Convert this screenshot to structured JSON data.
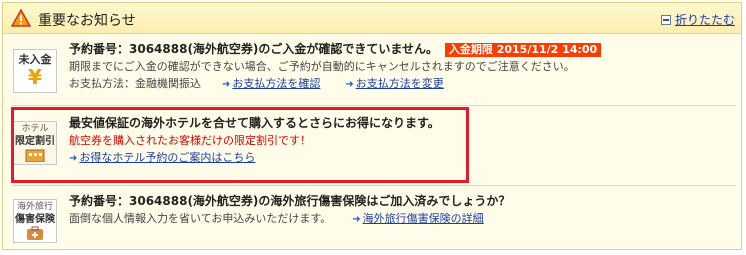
{
  "header": {
    "title": "重要なお知らせ",
    "collapse_label": "折りたたむ"
  },
  "notices": [
    {
      "badge": "未入金",
      "badge_symbol": "¥",
      "title": "予約番号：3064888(海外航空券)のご入金が確認できていません。",
      "deadline": "入金期限 2015/11/2 14:00",
      "body": "期限までにご入金の確認ができない場合、ご予約が自動的にキャンセルされますのでご注意ください。",
      "payment_label": "お支払方法：金融機関振込",
      "links": [
        "お支払方法を確認",
        "お支払方法を変更"
      ]
    },
    {
      "badge_line1": "ホテル",
      "badge_line2": "限定割引",
      "title": "最安値保証の海外ホテルを合せて購入するとさらにお得になります。",
      "red_text": "航空券を購入されたお客様だけの限定割引です！",
      "link": "お得なホテル予約のご案内はこちら"
    },
    {
      "badge_line1": "海外旅行",
      "badge_line2": "傷害保険",
      "title": "予約番号：3064888(海外航空券)の海外旅行傷害保険はご加入済みでしょうか？",
      "body": "面倒な個人情報入力を省いてお申込みいただけます。",
      "link": "海外旅行傷害保険の詳細"
    }
  ],
  "colors": {
    "accent_red": "#e21d2b",
    "deadline_bg": "#ff3c00",
    "link": "#1a3ea8",
    "header_bg": "#fdeeb0"
  },
  "icons": [
    "warning-icon",
    "yen-icon",
    "hotel-icon",
    "insurance-icon",
    "arrow-icon",
    "collapse-icon"
  ]
}
